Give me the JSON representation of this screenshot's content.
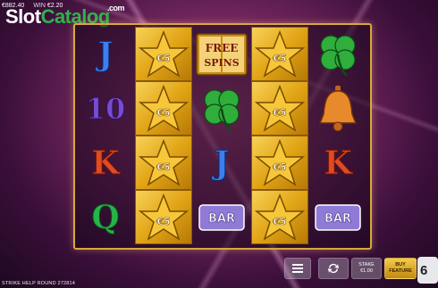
{
  "header": {
    "balance": "€882.40",
    "win_label": "WIN",
    "win_value": "€2.20",
    "logo_slot": "Slot",
    "logo_catalog": "Catalog",
    "logo_com": ".com"
  },
  "symbol_text": {
    "coin": "€5",
    "free": "FREE",
    "spins": "SPINS",
    "bar": "BAR",
    "j": "J",
    "ten": "10",
    "k": "K",
    "q": "Q"
  },
  "reels": [
    [
      "j-symbol",
      "ten-symbol",
      "k-symbol",
      "q-symbol"
    ],
    [
      "coin-star",
      "coin-star",
      "coin-star",
      "coin-star"
    ],
    [
      "free-spins-scatter",
      "clover-symbol",
      "j-symbol",
      "bar-symbol"
    ],
    [
      "coin-star",
      "coin-star",
      "coin-star",
      "coin-star"
    ],
    [
      "clover-symbol",
      "bell-symbol",
      "k-symbol",
      "bar-symbol"
    ]
  ],
  "footer": {
    "info_text": "STRIKE  HELP  ROUND  272814",
    "stake_label": "STAKE",
    "stake_value": "€1.00",
    "buy_label_1": "BUY",
    "buy_label_2": "FEATURE",
    "spin_partial": "6"
  },
  "colors": {
    "gold": "#e1a516",
    "frame": "#d8a640",
    "logo_green": "#2fb34a",
    "background": "#7a2a62"
  }
}
